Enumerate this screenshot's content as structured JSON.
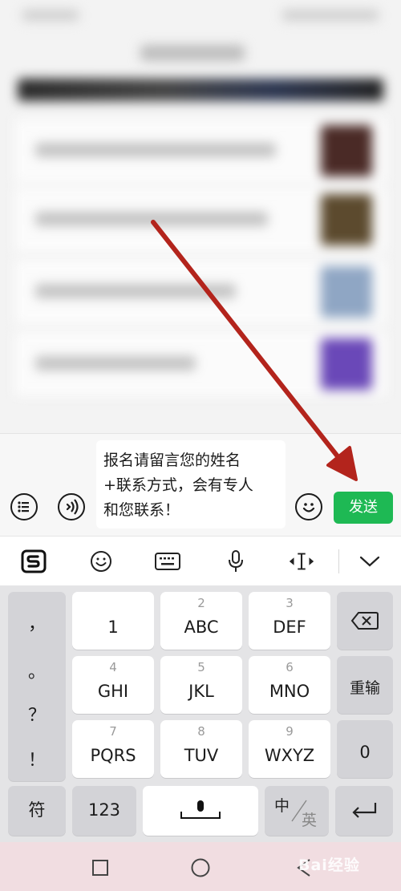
{
  "message": {
    "lines": [
      "报名请留言您的姓名",
      "+联系方式，会有专人",
      "和您联系！"
    ]
  },
  "send_label": "发送",
  "keyboard": {
    "punct": [
      "，",
      "。",
      "？",
      "！"
    ],
    "row1": [
      {
        "num": "",
        "label": "1"
      },
      {
        "num": "2",
        "label": "ABC"
      },
      {
        "num": "3",
        "label": "DEF"
      }
    ],
    "row2": [
      {
        "num": "4",
        "label": "GHI"
      },
      {
        "num": "5",
        "label": "JKL"
      },
      {
        "num": "6",
        "label": "MNO"
      }
    ],
    "row3": [
      {
        "num": "7",
        "label": "PQRS"
      },
      {
        "num": "8",
        "label": "TUV"
      },
      {
        "num": "9",
        "label": "WXYZ"
      }
    ],
    "reenter_label": "重输",
    "zero_label": "0",
    "symbol_label": "符",
    "numeric_label": "123",
    "lang_cn": "中",
    "lang_en": "英"
  },
  "watermark": "Bai经验",
  "colors": {
    "send_green": "#1eb954",
    "arrow_red": "#b3241c"
  },
  "icons": [
    "list-icon",
    "voice-icon",
    "emoji-icon",
    "sogou-logo-icon",
    "smiley-icon",
    "keyboard-icon",
    "microphone-icon",
    "cursor-move-icon",
    "chevron-down-icon",
    "backspace-icon",
    "enter-icon",
    "square-nav-icon",
    "circle-nav-icon",
    "back-nav-icon"
  ]
}
